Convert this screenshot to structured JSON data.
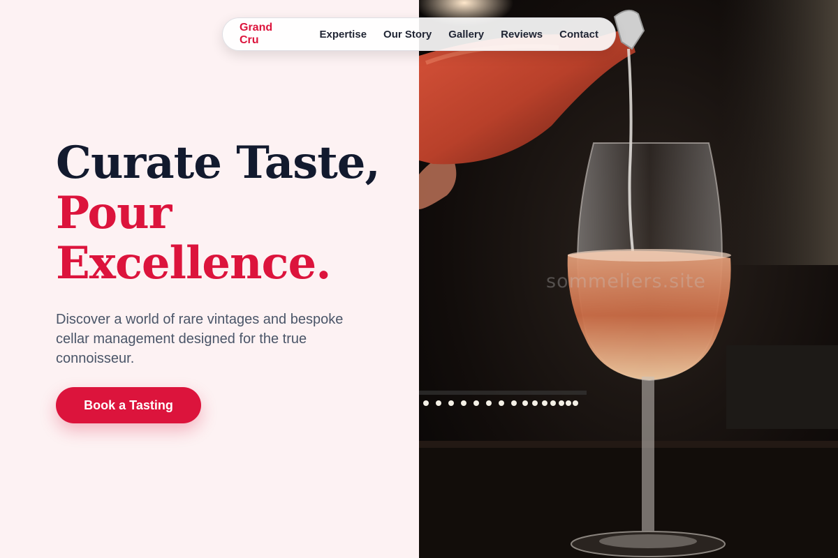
{
  "nav": {
    "brand": "Grand Cru",
    "links": [
      "Expertise",
      "Our Story",
      "Gallery",
      "Reviews",
      "Contact"
    ]
  },
  "hero": {
    "title_line1": "Curate Taste,",
    "title_line2": "Pour",
    "title_line3": "Excellence.",
    "description": "Discover a world of rare vintages and bespoke cellar management designed for the true connoisseur.",
    "cta_label": "Book a Tasting"
  },
  "photo": {
    "watermark": "sommeliers.site",
    "alt": "Wine being poured into a glass"
  },
  "colors": {
    "accent": "#dc143c",
    "heading": "#121a2e",
    "body_text": "#4a5568",
    "background": "#fdf2f3"
  }
}
